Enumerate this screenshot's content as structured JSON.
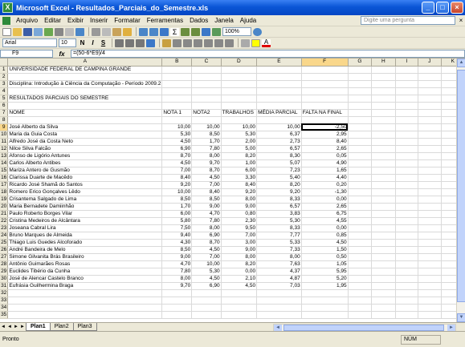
{
  "window": {
    "title": "Microsoft Excel - Resultados_Parciais_do_Semestre.xls"
  },
  "menu": {
    "items": [
      "Arquivo",
      "Editar",
      "Exibir",
      "Inserir",
      "Formatar",
      "Ferramentas",
      "Dados",
      "Janela",
      "Ajuda"
    ],
    "help_placeholder": "Digite uma pergunta"
  },
  "toolbar": {
    "zoom": "100%",
    "font": "Arial",
    "font_size": "10",
    "bold": "N",
    "italic": "I",
    "underline": "S"
  },
  "formula_bar": {
    "cell": "F9",
    "fx": "fx",
    "formula": "=(50-6*E9)/4"
  },
  "columns": [
    "A",
    "B",
    "C",
    "D",
    "E",
    "F",
    "G",
    "H",
    "I",
    "J",
    "K"
  ],
  "active": {
    "col": "F",
    "row": 9
  },
  "sheet": {
    "r1": "UNIVERSIDADE FEDERAL DE CAMPINA GRANDE",
    "r3": "Disciplina: Introdução à Ciência da Computação - Período 2009.2",
    "r5": "RESULTADOS PARCIAIS DO SEMESTRE",
    "headers": [
      "NOME",
      "NOTA 1",
      "NOTA2",
      "TRABALHOS",
      "MÉDIA PARCIAL",
      "FALTA NA FINAL"
    ],
    "students": [
      [
        "José Alberto da Silva",
        "10,00",
        "10,00",
        "10,00",
        "10,00",
        "-2,50"
      ],
      [
        "Maria da Guia Costa",
        "5,30",
        "8,50",
        "5,30",
        "6,37",
        "2,95"
      ],
      [
        "Alfredo José da Costa Neto",
        "4,50",
        "1,70",
        "2,00",
        "2,73",
        "8,40"
      ],
      [
        "Nilce Silva Falcão",
        "6,90",
        "7,80",
        "5,00",
        "6,57",
        "2,65"
      ],
      [
        "Afonso de Ligório Antunes",
        "8,70",
        "8,00",
        "8,20",
        "8,30",
        "0,05"
      ],
      [
        "Carlos Alberto Antibes",
        "4,50",
        "9,70",
        "1,00",
        "5,07",
        "4,90"
      ],
      [
        "Mariza Antero de Gusmão",
        "7,00",
        "8,70",
        "6,00",
        "7,23",
        "1,65"
      ],
      [
        "Clarissa Duarte de Macêdo",
        "8,40",
        "4,50",
        "3,30",
        "5,40",
        "4,40"
      ],
      [
        "Ricardo José Shamã do Santos",
        "9,20",
        "7,00",
        "8,40",
        "8,20",
        "0,20"
      ],
      [
        "Romero Erico Gonçalves Lêdo",
        "10,00",
        "8,40",
        "9,20",
        "9,20",
        "-1,30"
      ],
      [
        "Crisantema Salgado de Lima",
        "8,50",
        "8,50",
        "8,00",
        "8,33",
        "0,00"
      ],
      [
        "Maria Bernadete Damiinhão",
        "1,70",
        "9,00",
        "9,00",
        "6,57",
        "2,65"
      ],
      [
        "Paulo Roberto Borges Vilar",
        "6,00",
        "4,70",
        "0,80",
        "3,83",
        "6,75"
      ],
      [
        "Cristina Medeiros de Alcântara",
        "5,80",
        "7,80",
        "2,30",
        "5,30",
        "4,55"
      ],
      [
        "Joseana Cabral Lira",
        "7,50",
        "8,00",
        "9,50",
        "8,33",
        "0,00"
      ],
      [
        "Bruno Marques de Almeida",
        "9,40",
        "6,90",
        "7,00",
        "7,77",
        "0,85"
      ],
      [
        "Thiago Luis Guedes Alcoforado",
        "4,30",
        "8,70",
        "3,00",
        "5,33",
        "4,50"
      ],
      [
        "André Bandeira de Melo",
        "8,50",
        "4,50",
        "9,00",
        "7,33",
        "1,50"
      ],
      [
        "Simone Gilvanita Brás Brasileiro",
        "9,00",
        "7,00",
        "8,00",
        "8,00",
        "0,50"
      ],
      [
        "Antônio Guimarães Rosas",
        "4,70",
        "10,00",
        "8,20",
        "7,63",
        "1,05"
      ],
      [
        "Euclides Tibério da Cunha",
        "7,80",
        "5,30",
        "0,00",
        "4,37",
        "5,95"
      ],
      [
        "José de Alencar Castelo Branco",
        "8,00",
        "4,50",
        "2,10",
        "4,87",
        "5,20"
      ],
      [
        "Eufrásia Guilhermina Braga",
        "9,70",
        "6,90",
        "4,50",
        "7,03",
        "1,95"
      ]
    ]
  },
  "tabs": [
    "Plan1",
    "Plan2",
    "Plan3"
  ],
  "status": {
    "left": "Pronto",
    "num": "NÚM"
  }
}
